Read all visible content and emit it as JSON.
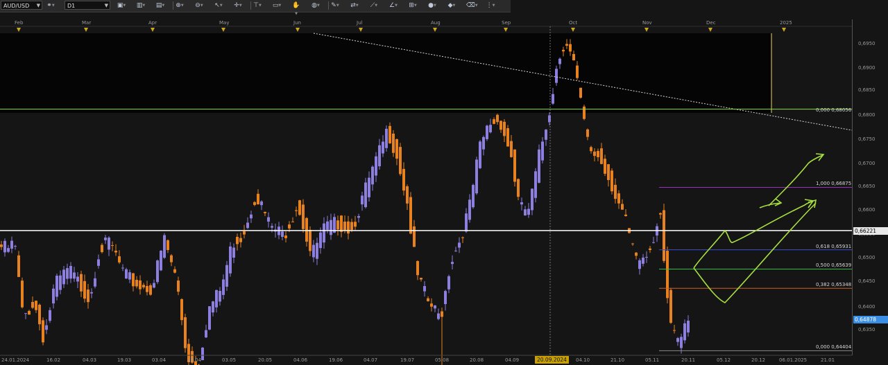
{
  "toolbar": {
    "symbol": "AUD/USD",
    "timeframe": "D1",
    "tools": [
      "chart-type-icon",
      "bar-chart-icon",
      "candles-icon",
      "zoom-in-icon",
      "zoom-out-icon",
      "cursor-icon",
      "crosshair-icon",
      "vertical-line-icon",
      "screenshot-icon",
      "hand-icon",
      "globe-icon",
      "pencil-icon",
      "sync-icon",
      "trend-icon",
      "angle-icon",
      "grid-icon",
      "circle-icon",
      "shapes-icon",
      "eraser-icon",
      "more-icon"
    ]
  },
  "colors": {
    "bull": "#8c7fe0",
    "bear": "#e8821e",
    "fib_high": "#9b2fc0",
    "fib_618": "#3b4fd0",
    "fib_500": "#33bb44",
    "fib_382": "#d06020",
    "fib_low": "#8a8a8a",
    "resistance": "#88e040",
    "support": "#ffffff",
    "arrows": "#a8e040",
    "current_tag": "#3a8ee6",
    "crosshair_tag": "#c8a000"
  },
  "months": [
    "Feb",
    "Mar",
    "Apr",
    "May",
    "Jun",
    "Jul",
    "Aug",
    "Sep",
    "Oct",
    "Nov",
    "Dec",
    "2025"
  ],
  "dates": [
    "24.01.2024",
    "16.02",
    "04.03",
    "19.03",
    "03.04",
    "18.04",
    "03.05",
    "20.05",
    "04.06",
    "19.06",
    "04.07",
    "19.07",
    "05.08",
    "20.08",
    "04.09",
    "20.09.2024",
    "04.10",
    "21.10",
    "05.11",
    "20.11",
    "05.12",
    "20.12",
    "06.01.2025",
    "21.01"
  ],
  "price_axis": [
    "0,6950",
    "0,6900",
    "0,6850",
    "0,6800",
    "0,6750",
    "0,6700",
    "0,6650",
    "0,6600",
    "0,6550",
    "0,6500",
    "0,6450",
    "0,6400",
    "0,6350"
  ],
  "fib_levels": [
    {
      "label": "1,000 0,66875",
      "price": 0.66875,
      "color_key": "fib_high"
    },
    {
      "label": "0,618 0,65931",
      "price": 0.65931,
      "color_key": "fib_618"
    },
    {
      "label": "0,500 0,65639",
      "price": 0.65639,
      "color_key": "fib_500"
    },
    {
      "label": "0,382 0,65348",
      "price": 0.65348,
      "color_key": "fib_382"
    },
    {
      "label": "0,000 0,64404",
      "price": 0.64404,
      "color_key": "fib_low"
    }
  ],
  "resistance": {
    "label": "0,000 0,68056",
    "price": 0.68056
  },
  "support": {
    "label": "0,66221",
    "price": 0.66221
  },
  "current_price": {
    "label": "0,64878",
    "price": 0.64878
  },
  "crosshair_date": "20.09.2024"
}
